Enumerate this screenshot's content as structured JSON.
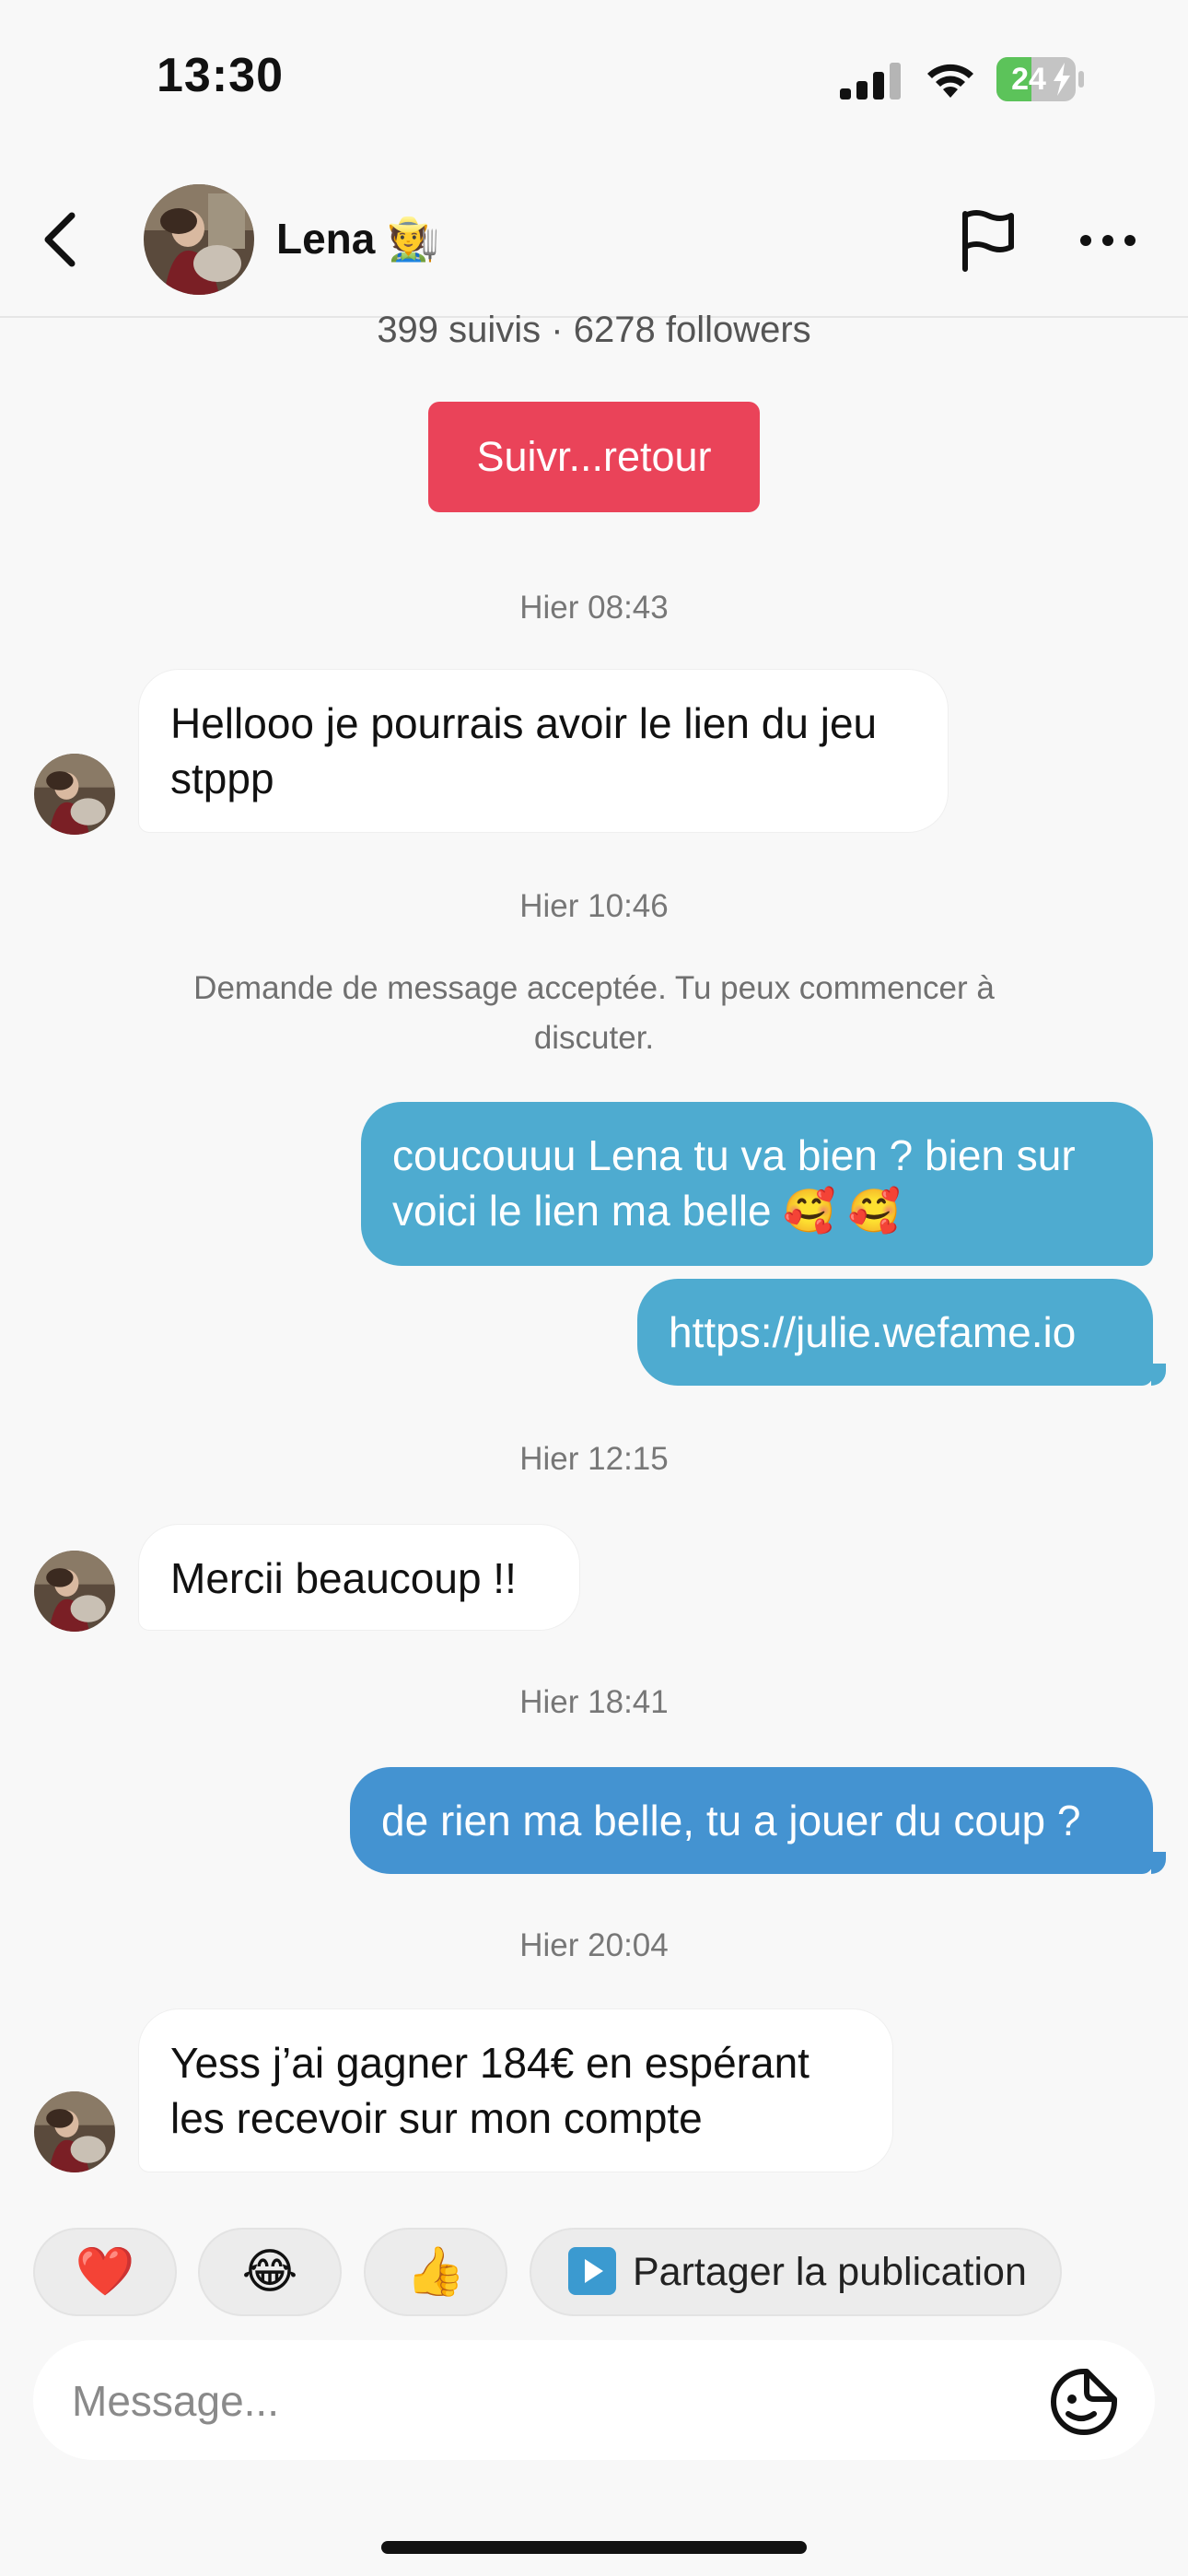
{
  "status_bar": {
    "time": "13:30",
    "battery_level": "24",
    "icons": [
      "signal-icon",
      "wifi-icon",
      "battery-charging-icon"
    ]
  },
  "header": {
    "name": "Lena 🧑‍🌾",
    "icons": [
      "back-arrow-icon",
      "flag-icon",
      "more-icon"
    ]
  },
  "profile": {
    "follow_info": "399 suivis · 6278 followers",
    "follow_back_button": "Suivr...retour"
  },
  "conversation": {
    "timestamps": [
      "Hier 08:43",
      "Hier 10:46",
      "Hier 12:15",
      "Hier 18:41",
      "Hier 20:04"
    ],
    "system_notice": "Demande de message acceptée. Tu peux commencer à discuter.",
    "messages": [
      {
        "from": "contact",
        "lines": [
          "Hellooo je pourrais avoir le lien du jeu",
          "stppp"
        ]
      },
      {
        "from": "me",
        "lines": [
          "coucouuu Lena tu va bien ? bien sur",
          "voici le lien ma belle 🥰 🥰"
        ]
      },
      {
        "from": "me",
        "lines": [
          "https://julie.wefame.io"
        ]
      },
      {
        "from": "contact",
        "lines": [
          "Mercii beaucoup !!"
        ]
      },
      {
        "from": "me",
        "lines": [
          "de rien ma belle, tu a jouer du coup ?"
        ]
      },
      {
        "from": "contact",
        "lines": [
          "Yess j’ai gagner 184€ en espérant",
          "les recevoir sur mon compte"
        ]
      }
    ],
    "colors": {
      "outgoing_bubble": "#4eabd0",
      "outgoing_bubble_alt": "#4493d1",
      "incoming_bubble": "#ffffff",
      "follow_button": "#ea4359"
    }
  },
  "quick_replies": {
    "reactions": [
      "❤️",
      "😂",
      "👍"
    ],
    "share_label": "Partager la publication"
  },
  "composer": {
    "placeholder": "Message..."
  }
}
